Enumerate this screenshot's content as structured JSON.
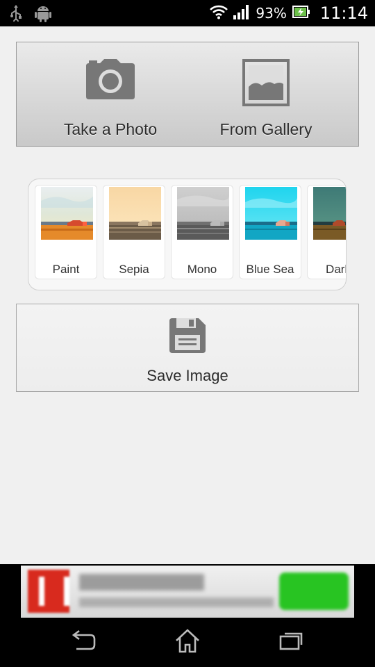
{
  "status_bar": {
    "battery_percent": "93%",
    "time": "11:14",
    "icons": [
      "usb-icon",
      "android-icon",
      "wifi-icon",
      "signal-icon",
      "battery-charging-icon"
    ]
  },
  "source": {
    "take_photo_label": "Take a Photo",
    "from_gallery_label": "From Gallery",
    "icons": [
      "camera-icon",
      "gallery-image-icon"
    ]
  },
  "filters": [
    {
      "label": "Paint"
    },
    {
      "label": "Sepia"
    },
    {
      "label": "Mono"
    },
    {
      "label": "Blue Sea"
    },
    {
      "label": "Dark"
    }
  ],
  "save": {
    "label": "Save Image",
    "icon": "floppy-disk-icon"
  },
  "navigation": {
    "icons": [
      "back-icon",
      "home-icon",
      "recent-apps-icon"
    ]
  },
  "colors": {
    "status_bar": "#000000",
    "background": "#f0f0f0",
    "ad_cta": "#28c422",
    "ad_logo": "#d82a1e"
  }
}
